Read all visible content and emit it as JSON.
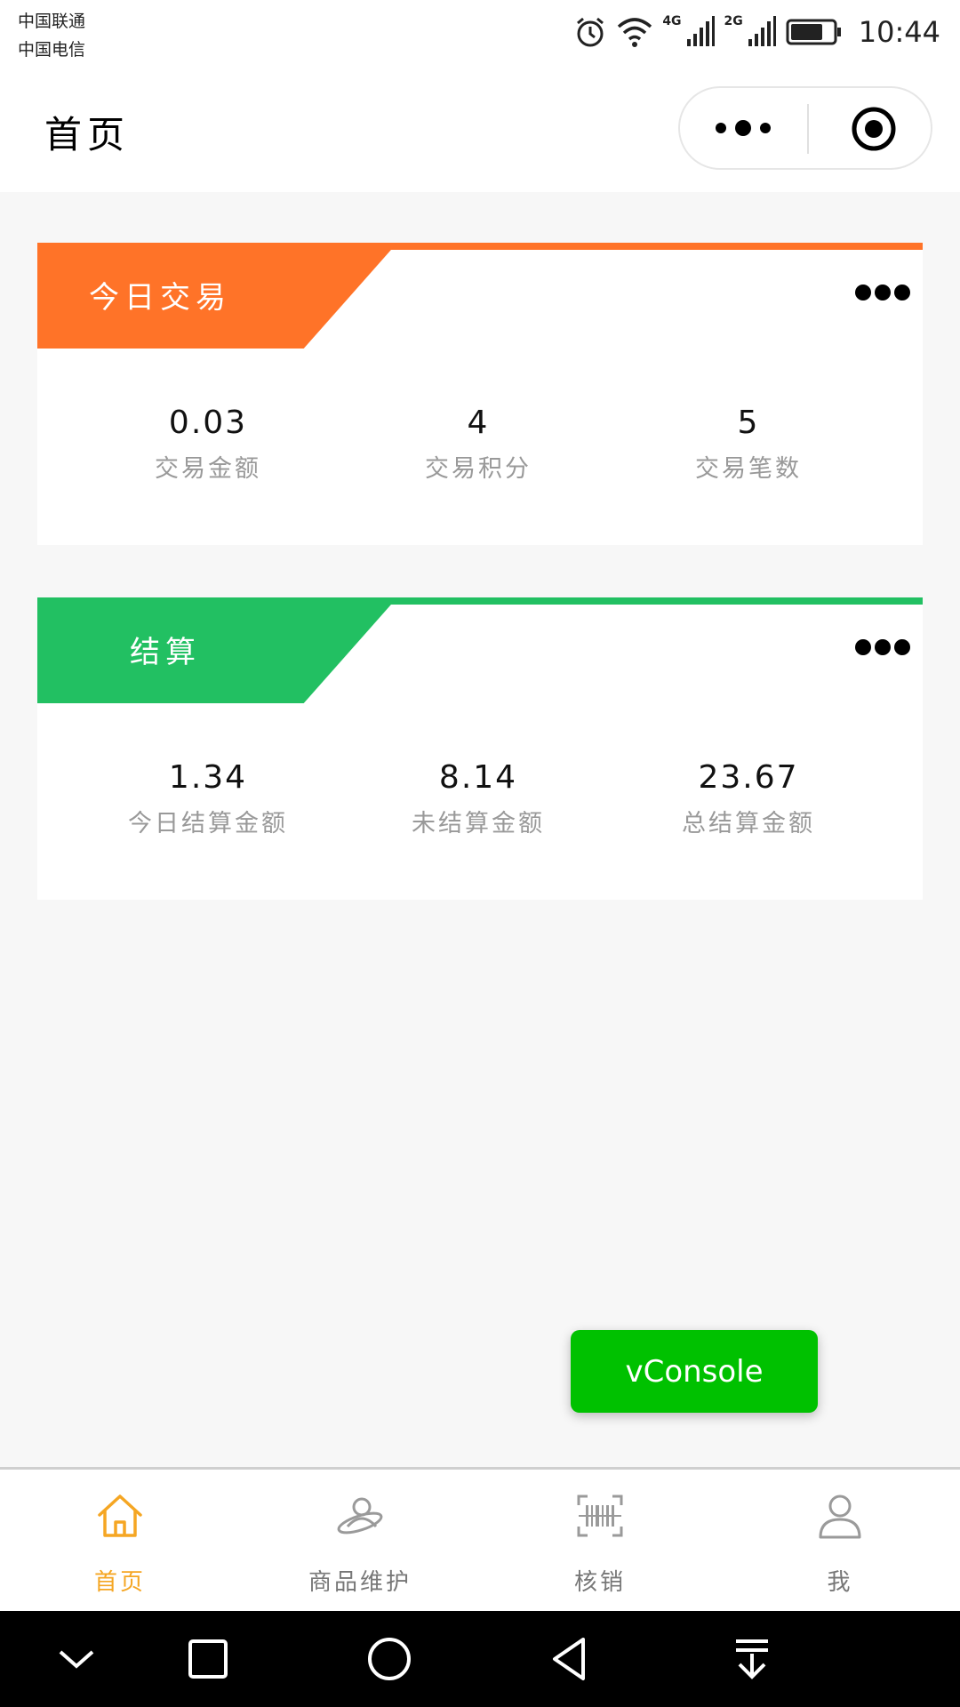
{
  "status_bar": {
    "carrier_1": "中国联通",
    "carrier_2": "中国电信",
    "network_1": "4G",
    "network_2": "2G",
    "time": "10:44",
    "battery_level": 0.75
  },
  "nav": {
    "title": "首页"
  },
  "cards": [
    {
      "title": "今日交易",
      "accent_color": "#ff7328",
      "stats": [
        {
          "value": "0.03",
          "label": "交易金额"
        },
        {
          "value": "4",
          "label": "交易积分"
        },
        {
          "value": "5",
          "label": "交易笔数"
        }
      ]
    },
    {
      "title": "结算",
      "accent_color": "#22c062",
      "stats": [
        {
          "value": "1.34",
          "label": "今日结算金额"
        },
        {
          "value": "8.14",
          "label": "未结算金额"
        },
        {
          "value": "23.67",
          "label": "总结算金额"
        }
      ]
    }
  ],
  "vconsole": {
    "label": "vConsole",
    "color": "#00c100"
  },
  "tabbar": {
    "active_color": "#f5a623",
    "items": [
      {
        "label": "首页",
        "icon": "home-icon",
        "active": true
      },
      {
        "label": "商品维护",
        "icon": "planet-user-icon",
        "active": false
      },
      {
        "label": "核销",
        "icon": "barcode-scan-icon",
        "active": false
      },
      {
        "label": "我",
        "icon": "user-icon",
        "active": false
      }
    ]
  },
  "system_nav": {
    "icons": [
      "chevron-down-icon",
      "recents-square-icon",
      "home-circle-icon",
      "back-triangle-icon",
      "notification-pulldown-icon"
    ]
  }
}
